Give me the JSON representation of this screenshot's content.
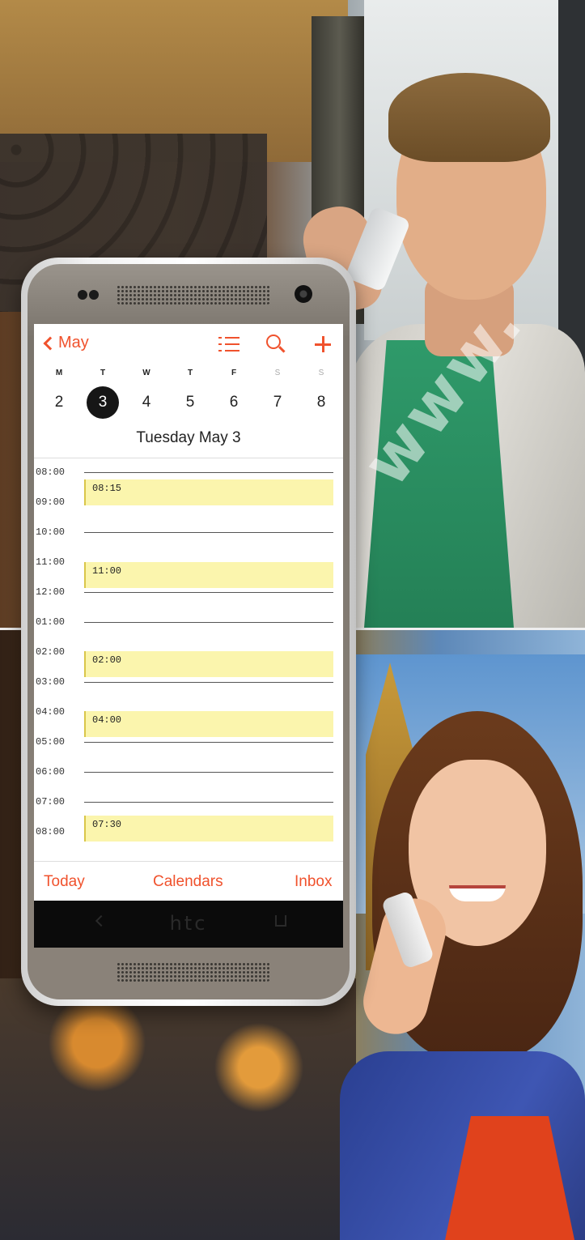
{
  "calendar": {
    "nav": {
      "back_label": "May",
      "icons": [
        "list-icon",
        "search-icon",
        "plus-icon"
      ]
    },
    "week": {
      "day_letters": [
        "M",
        "T",
        "W",
        "T",
        "F",
        "S",
        "S"
      ],
      "day_numbers": [
        "2",
        "3",
        "4",
        "5",
        "6",
        "7",
        "8"
      ],
      "selected_index": 1
    },
    "date_title": "Tuesday May 3",
    "hours": [
      "08:00",
      "09:00",
      "10:00",
      "11:00",
      "12:00",
      "01:00",
      "02:00",
      "03:00",
      "04:00",
      "05:00",
      "06:00",
      "07:00",
      "08:00"
    ],
    "events": [
      {
        "time": "08:15"
      },
      {
        "time": "11:00"
      },
      {
        "time": "02:00"
      },
      {
        "time": "04:00"
      },
      {
        "time": "07:30"
      }
    ],
    "tabs": {
      "today": "Today",
      "calendars": "Calendars",
      "inbox": "Inbox"
    }
  },
  "device": {
    "brand": "htc"
  },
  "watermark": "www.",
  "colors": {
    "accent": "#f0522d",
    "event_fill": "#fbf5ad",
    "selected_day": "#161616"
  }
}
